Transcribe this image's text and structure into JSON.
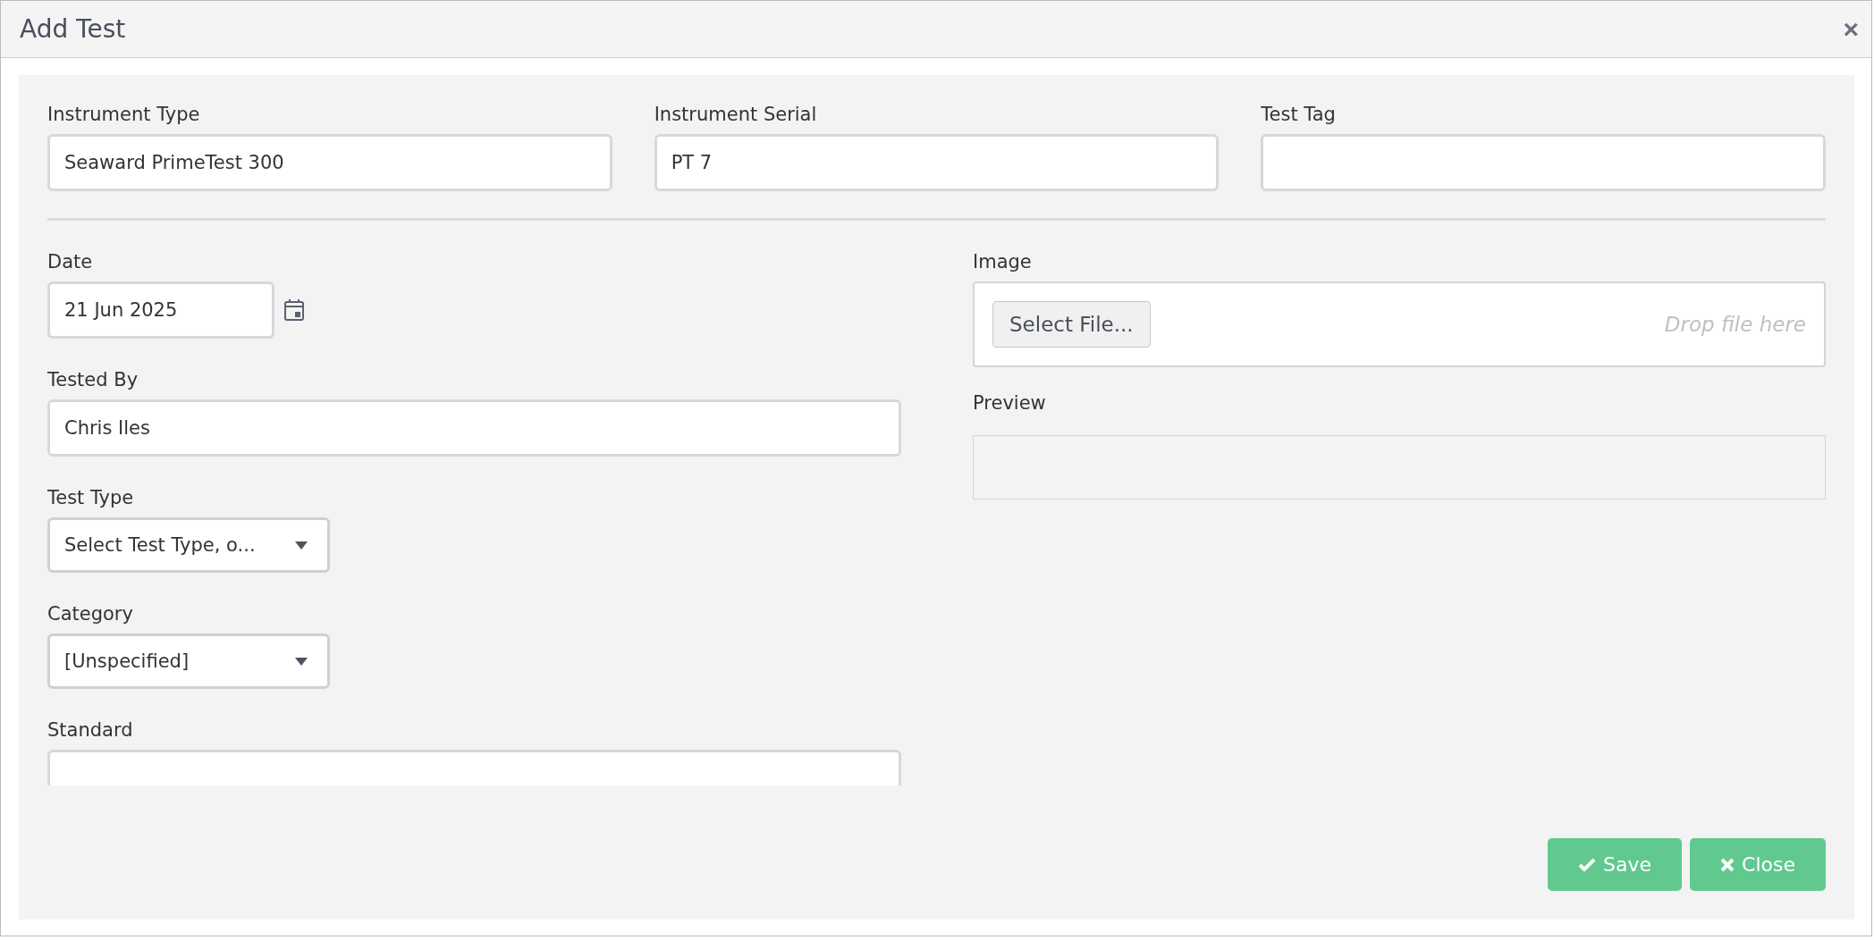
{
  "window": {
    "title": "Add Test",
    "close": "×"
  },
  "top_fields": [
    {
      "label": "Instrument Type",
      "value": "Seaward PrimeTest 300"
    },
    {
      "label": "Instrument Serial",
      "value": "PT 7"
    },
    {
      "label": "Test Tag"
    }
  ],
  "date": {
    "label": "Date",
    "value": "21 Jun 2025"
  },
  "tested_by": {
    "label": "Tested By",
    "value": "Chris Iles"
  },
  "test_type": {
    "label": "Test Type",
    "value": "Select Test Type, o..."
  },
  "category": {
    "label": "Category",
    "value": "[Unspecified]"
  },
  "standard": {
    "label": "Standard"
  },
  "image": {
    "label": "Image",
    "button": "Select File...",
    "placeholder": "Drop file here"
  },
  "preview": {
    "label": "Preview"
  },
  "buttons": [
    {
      "label": "Save",
      "kind": "save"
    },
    {
      "label": "Close",
      "kind": "close"
    }
  ]
}
